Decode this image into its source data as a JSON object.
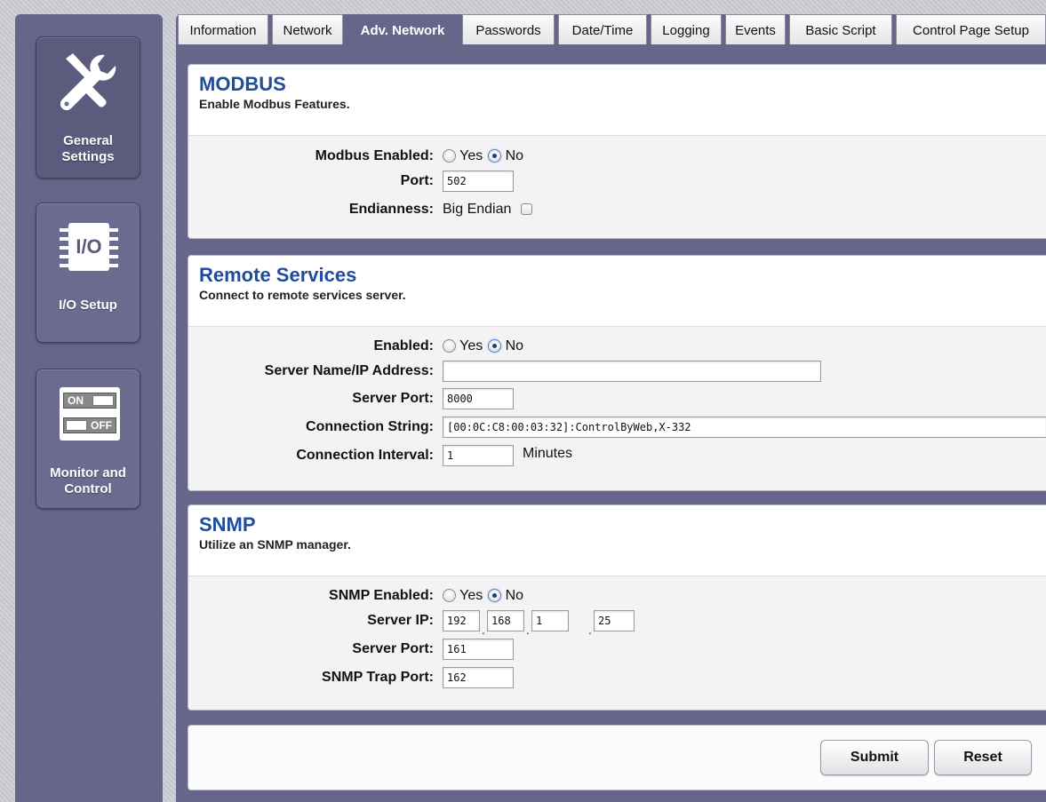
{
  "sidebar": {
    "items": [
      {
        "label_line1": "General",
        "label_line2": "Settings",
        "icon": "wrench-screwdriver-icon"
      },
      {
        "label_line1": "I/O Setup",
        "icon_text": "I/O",
        "icon": "io-chip-icon"
      },
      {
        "label_line1": "Monitor and",
        "label_line2": "Control",
        "icon": "on-off-switch-icon",
        "switch_on": "ON",
        "switch_off": "OFF"
      }
    ]
  },
  "tabs": [
    "Information",
    "Network",
    "Adv. Network",
    "Passwords",
    "Date/Time",
    "Logging",
    "Events",
    "Basic Script",
    "Control Page Setup"
  ],
  "active_tab": "Adv. Network",
  "modbus": {
    "title": "MODBUS",
    "subtitle": "Enable Modbus Features.",
    "enabled_label": "Modbus Enabled:",
    "yes": "Yes",
    "no": "No",
    "port_label": "Port:",
    "port": "502",
    "endianness_label": "Endianness:",
    "endianness_value": "Big Endian"
  },
  "remote": {
    "title": "Remote Services",
    "subtitle": "Connect to remote services server.",
    "enabled_label": "Enabled:",
    "yes": "Yes",
    "no": "No",
    "server_label": "Server Name/IP Address:",
    "server": "",
    "port_label": "Server Port:",
    "port": "8000",
    "conn_string_label": "Connection String:",
    "conn_string": "[00:0C:C8:00:03:32]:ControlByWeb,X-332",
    "interval_label": "Connection Interval:",
    "interval": "1",
    "interval_unit": "Minutes"
  },
  "snmp": {
    "title": "SNMP",
    "subtitle": "Utilize an SNMP manager.",
    "enabled_label": "SNMP Enabled:",
    "yes": "Yes",
    "no": "No",
    "server_ip_label": "Server IP:",
    "ip1": "192",
    "ip2": "168",
    "ip3": "1",
    "ip4": "25",
    "port_label": "Server Port:",
    "port": "161",
    "trap_label": "SNMP Trap Port:",
    "trap_port": "162"
  },
  "actions": {
    "submit": "Submit",
    "reset": "Reset"
  }
}
